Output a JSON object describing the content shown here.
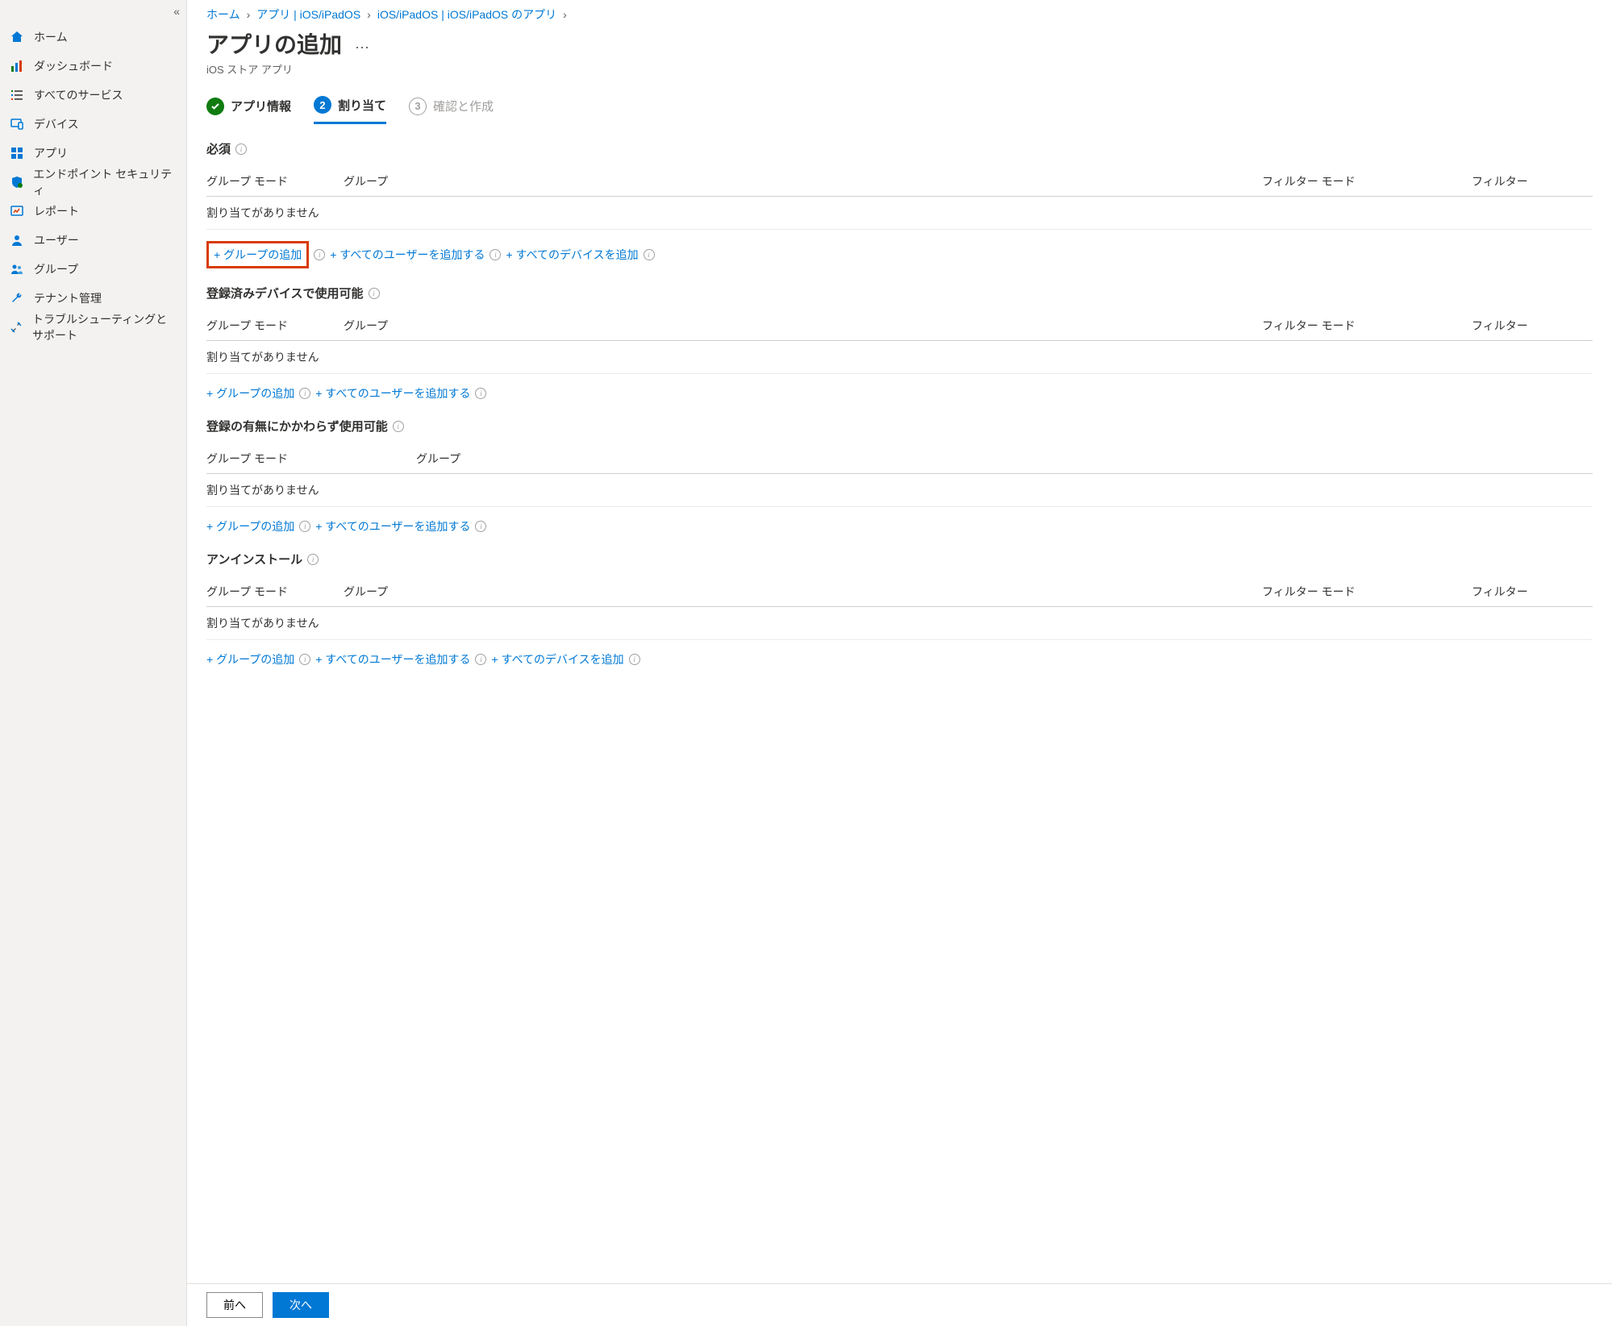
{
  "sidebar": {
    "items": [
      {
        "label": "ホーム",
        "icon": "home"
      },
      {
        "label": "ダッシュボード",
        "icon": "dashboard"
      },
      {
        "label": "すべてのサービス",
        "icon": "list"
      },
      {
        "label": "デバイス",
        "icon": "device"
      },
      {
        "label": "アプリ",
        "icon": "grid"
      },
      {
        "label": "エンドポイント セキュリティ",
        "icon": "shield"
      },
      {
        "label": "レポート",
        "icon": "report"
      },
      {
        "label": "ユーザー",
        "icon": "user"
      },
      {
        "label": "グループ",
        "icon": "group"
      },
      {
        "label": "テナント管理",
        "icon": "wrench"
      },
      {
        "label": "トラブルシューティングとサポート",
        "icon": "tools"
      }
    ]
  },
  "breadcrumb": {
    "items": [
      "ホーム",
      "アプリ | iOS/iPadOS",
      "iOS/iPadOS | iOS/iPadOS のアプリ"
    ]
  },
  "page": {
    "title": "アプリの追加",
    "subtitle": "iOS ストア アプリ"
  },
  "steps": {
    "s1": {
      "label": "アプリ情報"
    },
    "s2": {
      "num": "2",
      "label": "割り当て"
    },
    "s3": {
      "num": "3",
      "label": "確認と作成"
    }
  },
  "columns": {
    "group_mode": "グループ モード",
    "group": "グループ",
    "filter_mode": "フィルター モード",
    "filter": "フィルター"
  },
  "empty": "割り当てがありません",
  "actions": {
    "add_group": "+ グループの追加",
    "add_all_users": "+ すべてのユーザーを追加する",
    "add_all_devices": "+ すべてのデバイスを追加"
  },
  "sections": {
    "required": "必須",
    "available_enrolled": "登録済みデバイスで使用可能",
    "available_all": "登録の有無にかかわらず使用可能",
    "uninstall": "アンインストール"
  },
  "footer": {
    "prev": "前へ",
    "next": "次へ"
  }
}
